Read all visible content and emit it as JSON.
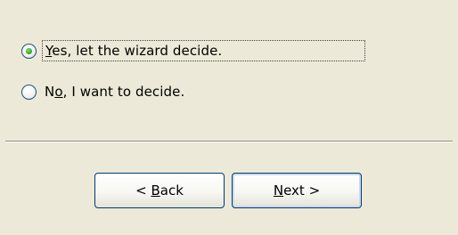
{
  "options": {
    "yes": {
      "accel": "Y",
      "rest": "es, let the wizard decide.",
      "selected": true
    },
    "no": {
      "pre": "N",
      "accel": "o",
      "rest": ", I want to decide.",
      "selected": false
    }
  },
  "buttons": {
    "back": {
      "pre": "< ",
      "accel": "B",
      "rest": "ack"
    },
    "next": {
      "accel": "N",
      "rest": "ext >"
    }
  }
}
